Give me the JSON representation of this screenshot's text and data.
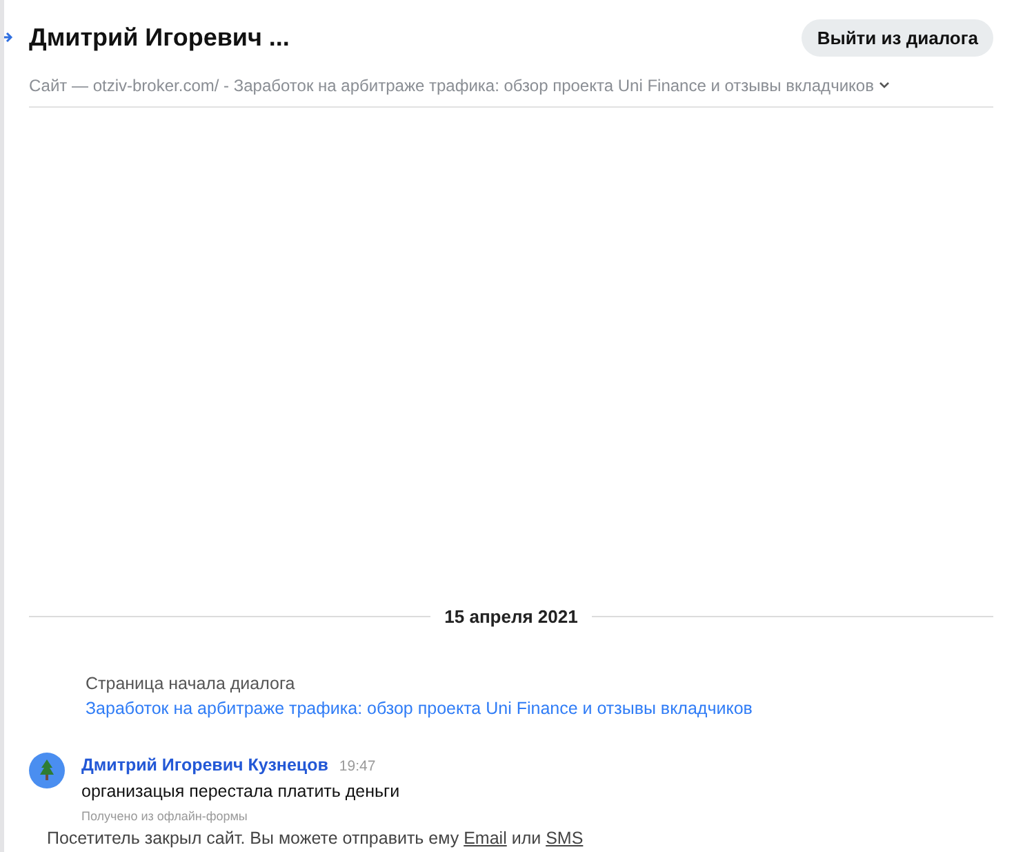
{
  "header": {
    "title": "Дмитрий Игоревич ...",
    "exit_button": "Выйти из диалога",
    "site_line": "Сайт — otziv-broker.com/ - Заработок на арбитраже трафика: обзор проекта Uni Finance и отзывы вкладчиков",
    "expanded": false
  },
  "date_divider": "15 апреля 2021",
  "start_page": {
    "label": "Страница начала диалога",
    "link": "Заработок на арбитраже трафика: обзор проекта Uni Finance и отзывы вкладчиков"
  },
  "messages": [
    {
      "author": "Дмитрий Игоревич Кузнецов",
      "time": "19:47",
      "text": "организацыя перестала платить деньги",
      "note": "Получено из офлайн-формы"
    }
  ],
  "closed_notice": {
    "before": "Посетитель закрыл сайт. Вы можете отправить ему ",
    "email_link": "Email",
    "middle": " или ",
    "sms_link": "SMS"
  }
}
